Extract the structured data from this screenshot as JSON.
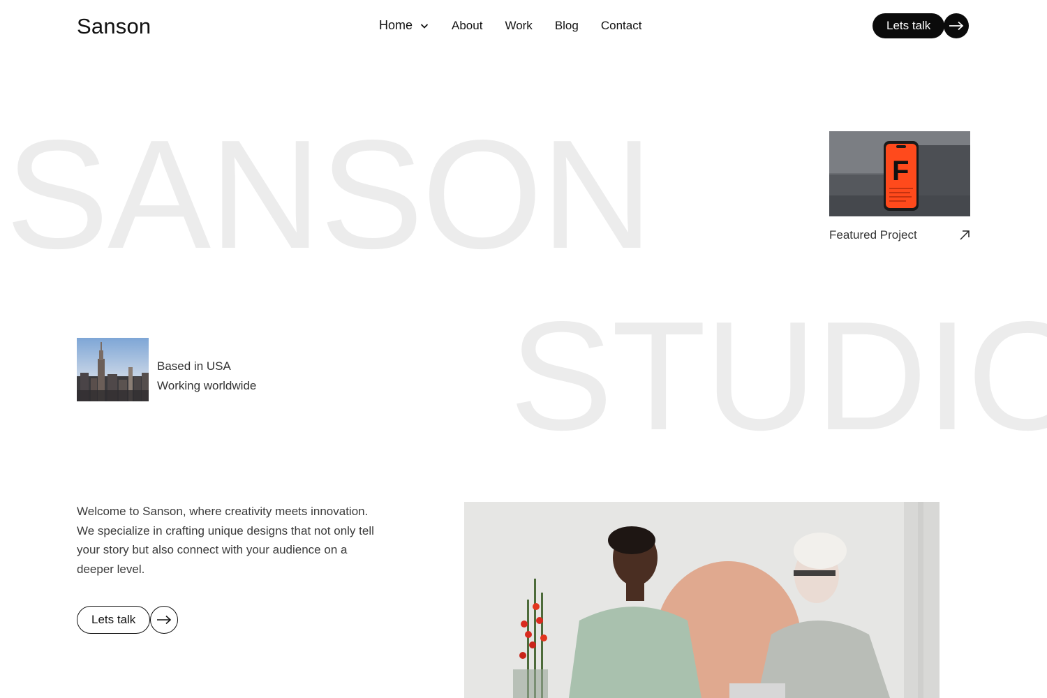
{
  "header": {
    "logo": "Sanson",
    "nav": [
      "Home",
      "About",
      "Work",
      "Blog",
      "Contact"
    ],
    "cta_label": "Lets talk"
  },
  "hero": {
    "word_1": "SANSON",
    "word_2": "STUDIO"
  },
  "featured": {
    "label": "Featured Project",
    "phone_letter": "F"
  },
  "location": {
    "line_1": "Based in USA",
    "line_2": "Working worldwide"
  },
  "intro": {
    "text": "Welcome to Sanson, where creativity meets innovation. We specialize in crafting unique designs that not only tell your story but also connect with your audience on a deeper level.",
    "cta_label": "Lets talk"
  },
  "colors": {
    "accent": "#0b0b0b",
    "giant_text": "#ececec",
    "phone_screen": "#ff4a1c"
  },
  "icons": {
    "nav_dropdown": "chevron-down-icon",
    "cta_arrow": "arrow-right-icon",
    "featured_arrow": "arrow-up-right-icon"
  }
}
